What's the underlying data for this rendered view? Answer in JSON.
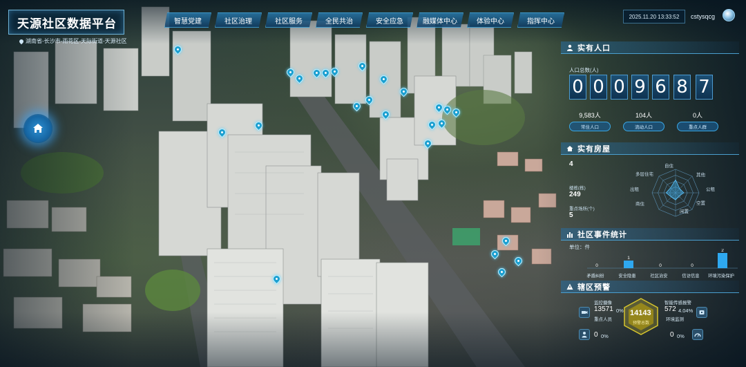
{
  "header": {
    "title": "天源社区数据平台",
    "location": "湖南省-长沙市-雨花区-天际街道-天源社区",
    "nav": [
      {
        "label": "智慧党建"
      },
      {
        "label": "社区治理"
      },
      {
        "label": "社区服务"
      },
      {
        "label": "全民共治"
      },
      {
        "label": "安全应急"
      },
      {
        "label": "融媒体中心"
      },
      {
        "label": "体验中心"
      },
      {
        "label": "指挥中心"
      }
    ],
    "datetime": "2025.11.20 13:33:52",
    "username": "cstysqcg"
  },
  "population": {
    "title": "实有人口",
    "total_label": "人口总数(人)",
    "digits": [
      "0",
      "0",
      "0",
      "9",
      "6",
      "8",
      "7"
    ],
    "breakdown": [
      {
        "value": "9,583人",
        "label": "常住人口"
      },
      {
        "value": "104人",
        "label": "流动人口"
      },
      {
        "value": "0人",
        "label": "重点人群"
      }
    ]
  },
  "housing": {
    "title": "实有房屋",
    "items": [
      {
        "label": "",
        "value": "4"
      },
      {
        "label": "楼栋(栋)",
        "value": "249"
      },
      {
        "label": "重点场所(个)",
        "value": "5"
      }
    ],
    "radar_labels": [
      "自住",
      "其他",
      "公租",
      "空置",
      "闲置",
      "商住",
      "出租",
      "多层住宅"
    ],
    "radar_values": [
      0.55,
      0.25,
      0.35,
      0.2,
      0.3,
      0.25,
      0.4,
      0.3
    ]
  },
  "events": {
    "title": "社区事件统计",
    "unit": "单位：件",
    "categories": [
      "矛盾纠纷",
      "安全隐患",
      "社区治安",
      "信访信息",
      "环境污染保护"
    ],
    "values": [
      0,
      1,
      0,
      0,
      2
    ]
  },
  "alerts": {
    "title": "辖区预警",
    "left_top_label": "监控摄像",
    "left_top_value": "13571",
    "left_top_pct": "0%",
    "left_top_sub": "重点人员",
    "left_bottom_value": "0",
    "left_bottom_pct": "0%",
    "center_value": "14143",
    "center_label": "预警总数",
    "right_top_label": "智能传感报警",
    "right_top_value": "572",
    "right_top_pct": "4.04%",
    "right_top_sub": "环境监测",
    "right_bottom_value": "0",
    "right_bottom_pct": "0%"
  },
  "colors": {
    "accent": "#2aa6e8",
    "bar": "#2ea8f0",
    "gold": "#d6c42c"
  }
}
